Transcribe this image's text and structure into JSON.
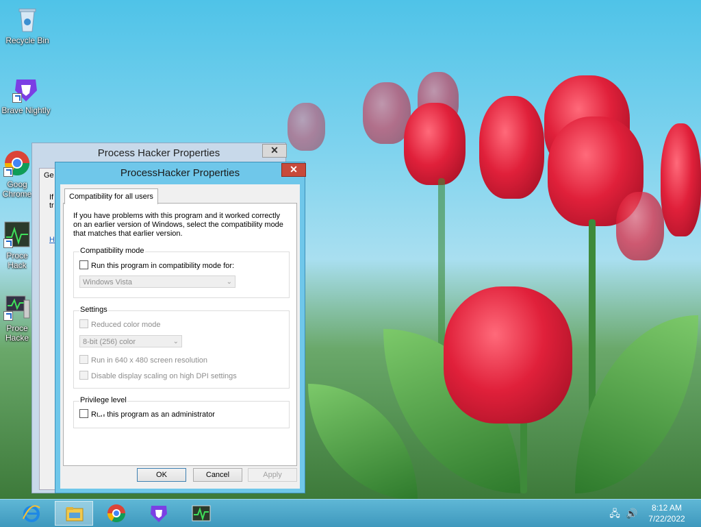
{
  "desktop": {
    "icons": [
      {
        "label": "Recycle Bin",
        "icon": "recycle-bin-icon"
      },
      {
        "label": "Brave Nightly",
        "icon": "brave-lion-icon",
        "badge": "nightly"
      },
      {
        "label": "Goog Chrome",
        "icon": "chrome-icon"
      },
      {
        "label": "Proce Hack",
        "icon": "process-hacker-icon"
      },
      {
        "label": "Proce Hacke",
        "icon": "process-hacker-computer-icon"
      }
    ]
  },
  "back_window": {
    "title": "Process Hacker Properties",
    "close": "✕",
    "partial_tab": "Ge",
    "partial_text": [
      "If",
      "tr"
    ],
    "partial_link": "H"
  },
  "dialog": {
    "title": "ProcessHacker Properties",
    "close": "✕",
    "tab_label": "Compatibility for all users",
    "intro": "If you have problems with this program and it worked correctly on an earlier version of Windows, select the compatibility mode that matches that earlier version.",
    "compat": {
      "label": "Compatibility mode",
      "checkbox_label": "Run this program in compatibility mode for:",
      "checked": false,
      "select_value": "Windows Vista"
    },
    "settings": {
      "label": "Settings",
      "reduced_color": "Reduced color mode",
      "color_select": "8-bit (256) color",
      "run_640": "Run in 640 x 480 screen resolution",
      "disable_dpi": "Disable display scaling on high DPI settings"
    },
    "privilege": {
      "label": "Privilege level",
      "checkbox_label": "Run this program as an administrator",
      "checked": false
    },
    "buttons": {
      "ok": "OK",
      "cancel": "Cancel",
      "apply": "Apply"
    }
  },
  "taskbar": {
    "items": [
      {
        "name": "internet-explorer",
        "icon": "ie-icon"
      },
      {
        "name": "file-explorer",
        "icon": "folder-icon",
        "active": true
      },
      {
        "name": "chrome",
        "icon": "chrome-icon"
      },
      {
        "name": "brave-nightly",
        "icon": "brave-lion-icon"
      },
      {
        "name": "process-hacker",
        "icon": "activity-graph-icon"
      }
    ],
    "clock": {
      "time": "8:12 AM",
      "date": "7/22/2022"
    }
  },
  "colors": {
    "accent": "#6fc7ea",
    "close": "#c84a3a",
    "taskbar": "#4aa6c9"
  }
}
